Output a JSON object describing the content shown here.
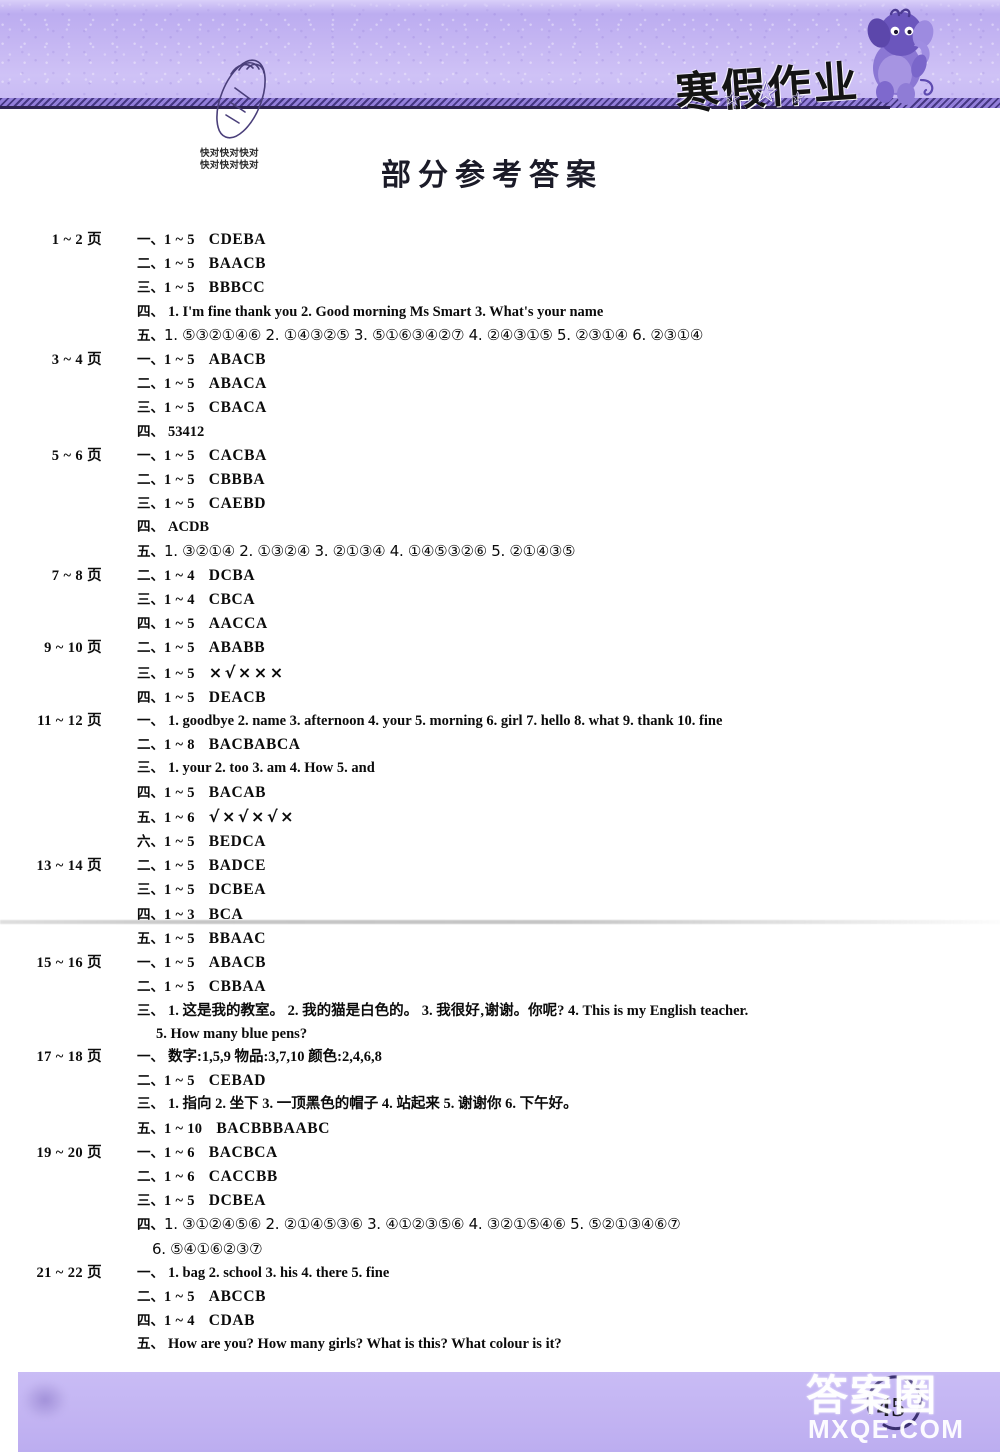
{
  "header": {
    "homework_title": "寒假作业",
    "carrot_note_line1": "快对快对快对",
    "carrot_note_line2": "快对快对快对",
    "mascot": "elephant-mascot"
  },
  "page_title": "部分参考答案",
  "footer": {
    "page_number": "45",
    "watermark_cjk": "答案圈",
    "watermark_url": "MXQE.COM"
  },
  "groups": [
    {
      "pages": "1 ~ 2 页",
      "rows": [
        {
          "marker": "一、",
          "range": "1 ~ 5",
          "answer": "CDEBA"
        },
        {
          "marker": "二、",
          "range": "1 ~ 5",
          "answer": "BAACB"
        },
        {
          "marker": "三、",
          "range": "1 ~ 5",
          "answer": "BBBCC"
        },
        {
          "marker": "四、",
          "text": "1. I'm fine   thank you   2. Good morning   Ms Smart   3. What's your name"
        },
        {
          "marker": "五、",
          "text": "1. ⑤③②①④⑥   2. ①④③②⑤   3. ⑤①⑥③④②⑦   4. ②④③①⑤   5. ②③①④   6. ②③①④",
          "circled": true
        }
      ]
    },
    {
      "pages": "3 ~ 4 页",
      "rows": [
        {
          "marker": "一、",
          "range": "1 ~ 5",
          "answer": "ABACB"
        },
        {
          "marker": "二、",
          "range": "1 ~ 5",
          "answer": "ABACA"
        },
        {
          "marker": "三、",
          "range": "1 ~ 5",
          "answer": "CBACA"
        },
        {
          "marker": "四、",
          "text": "53412"
        }
      ]
    },
    {
      "pages": "5 ~ 6 页",
      "rows": [
        {
          "marker": "一、",
          "range": "1 ~ 5",
          "answer": "CACBA"
        },
        {
          "marker": "二、",
          "range": "1 ~ 5",
          "answer": "CBBBA"
        },
        {
          "marker": "三、",
          "range": "1 ~ 5",
          "answer": "CAEBD"
        },
        {
          "marker": "四、",
          "text": "ACDB"
        },
        {
          "marker": "五、",
          "text": "1. ③②①④   2. ①③②④   3. ②①③④   4. ①④⑤③②⑥   5. ②①④③⑤",
          "circled": true
        }
      ]
    },
    {
      "pages": "7 ~ 8 页",
      "rows": [
        {
          "marker": "二、",
          "range": "1 ~ 4",
          "answer": "DCBA"
        },
        {
          "marker": "三、",
          "range": "1 ~ 4",
          "answer": "CBCA"
        },
        {
          "marker": "四、",
          "range": "1 ~ 5",
          "answer": "AACCA"
        }
      ]
    },
    {
      "pages": "9 ~ 10 页",
      "rows": [
        {
          "marker": "二、",
          "range": "1 ~ 5",
          "answer": "ABABB"
        },
        {
          "marker": "三、",
          "range": "1 ~ 5",
          "marks": "×√×××"
        },
        {
          "marker": "四、",
          "range": "1 ~ 5",
          "answer": "DEACB"
        }
      ]
    },
    {
      "pages": "11 ~ 12 页",
      "rows": [
        {
          "marker": "一、",
          "text": "1. goodbye   2. name   3. afternoon   4. your   5. morning   6. girl   7. hello   8. what   9. thank   10. fine"
        },
        {
          "marker": "二、",
          "range": "1 ~ 8",
          "answer": "BACBABCA"
        },
        {
          "marker": "三、",
          "text": "1. your   2. too   3. am   4. How   5. and"
        },
        {
          "marker": "四、",
          "range": "1 ~ 5",
          "answer": "BACAB"
        },
        {
          "marker": "五、",
          "range": "1 ~ 6",
          "marks": "√×√×√×"
        },
        {
          "marker": "六、",
          "range": "1 ~ 5",
          "answer": "BEDCA"
        }
      ]
    },
    {
      "pages": "13 ~ 14 页",
      "rows": [
        {
          "marker": "二、",
          "range": "1 ~ 5",
          "answer": "BADCE"
        },
        {
          "marker": "三、",
          "range": "1 ~ 5",
          "answer": "DCBEA"
        },
        {
          "marker": "四、",
          "range": "1 ~ 3",
          "answer": "BCA"
        },
        {
          "marker": "五、",
          "range": "1 ~ 5",
          "answer": "BBAAC"
        }
      ]
    },
    {
      "pages": "15 ~ 16 页",
      "rows": [
        {
          "marker": "一、",
          "range": "1 ~ 5",
          "answer": "ABACB"
        },
        {
          "marker": "二、",
          "range": "1 ~ 5",
          "answer": "CBBAA"
        },
        {
          "marker": "三、",
          "text": "1. 这是我的教室。   2. 我的猫是白色的。   3. 我很好‚谢谢。你呢?   4. This is my English teacher."
        },
        {
          "continuation": true,
          "text": "5. How many blue pens?"
        }
      ]
    },
    {
      "pages": "17 ~ 18 页",
      "rows": [
        {
          "marker": "一、",
          "text": "数字:1,5,9   物品:3,7,10   颜色:2,4,6,8"
        },
        {
          "marker": "二、",
          "range": "1 ~ 5",
          "answer": "CEBAD"
        },
        {
          "marker": "三、",
          "text": "1. 指向   2. 坐下   3. 一顶黑色的帽子   4. 站起来   5. 谢谢你   6. 下午好。"
        },
        {
          "marker": "五、",
          "range": "1 ~ 10",
          "answer": "BACBBBAABC"
        }
      ]
    },
    {
      "pages": "19 ~ 20 页",
      "rows": [
        {
          "marker": "一、",
          "range": "1 ~ 6",
          "answer": "BACBCA"
        },
        {
          "marker": "二、",
          "range": "1 ~ 6",
          "answer": "CACCBB"
        },
        {
          "marker": "三、",
          "range": "1 ~ 5",
          "answer": "DCBEA"
        },
        {
          "marker": "四、",
          "text": "1. ③①②④⑤⑥   2. ②①④⑤③⑥   3. ④①②③⑤⑥   4. ③②①⑤④⑥   5. ⑤②①③④⑥⑦",
          "circled": true
        },
        {
          "continuation": true,
          "text": "6. ⑤④①⑥②③⑦",
          "circled": true
        }
      ]
    },
    {
      "pages": "21 ~ 22 页",
      "rows": [
        {
          "marker": "一、",
          "text": "1. bag   2. school   3. his   4. there   5. fine"
        },
        {
          "marker": "二、",
          "range": "1 ~ 5",
          "answer": "ABCCB"
        },
        {
          "marker": "四、",
          "range": "1 ~ 4",
          "answer": "CDAB"
        },
        {
          "marker": "五、",
          "text": "How are you?    How many girls?    What is this?    What colour is it?"
        }
      ]
    }
  ]
}
